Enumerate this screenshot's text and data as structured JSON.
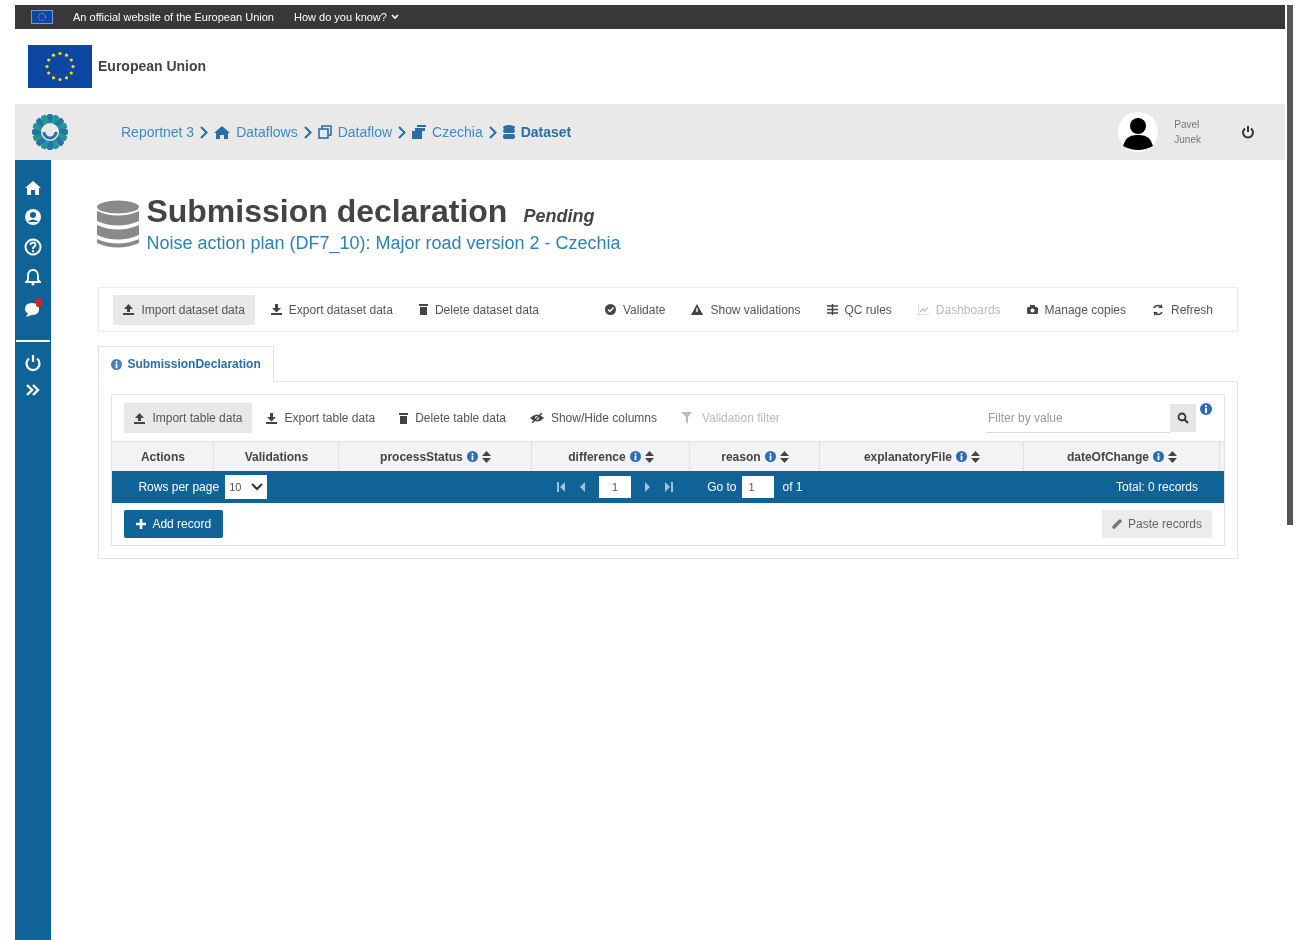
{
  "eu_banner": {
    "text": "An official website of the European Union",
    "link": "How do you know?"
  },
  "header": {
    "title": "European Union"
  },
  "breadcrumb": [
    {
      "label": "Reportnet 3",
      "current": false
    },
    {
      "label": "Dataflows",
      "current": false
    },
    {
      "label": "Dataflow",
      "current": false
    },
    {
      "label": "Czechia",
      "current": false
    },
    {
      "label": "Dataset",
      "current": true
    }
  ],
  "user": {
    "first_name": "Pavel",
    "last_name": "Junek"
  },
  "sidebar": {
    "notification_badge": true
  },
  "page": {
    "title": "Submission declaration",
    "status": "Pending",
    "subtitle": "Noise action plan (DF7_10): Major road version 2 - Czechia"
  },
  "dataset_toolbar": [
    {
      "label": "Import dataset data",
      "selected": true,
      "disabled": false
    },
    {
      "label": "Export dataset data",
      "selected": false,
      "disabled": false
    },
    {
      "label": "Delete dataset data",
      "selected": false,
      "disabled": false
    },
    {
      "label": "Validate",
      "selected": false,
      "disabled": false
    },
    {
      "label": "Show validations",
      "selected": false,
      "disabled": false
    },
    {
      "label": "QC rules",
      "selected": false,
      "disabled": false
    },
    {
      "label": "Dashboards",
      "selected": false,
      "disabled": true
    },
    {
      "label": "Manage copies",
      "selected": false,
      "disabled": false
    },
    {
      "label": "Refresh",
      "selected": false,
      "disabled": false
    }
  ],
  "tabs": [
    {
      "label": "SubmissionDeclaration",
      "selected": true
    }
  ],
  "table_toolbar": [
    {
      "label": "Import table data",
      "selected": true,
      "disabled": false
    },
    {
      "label": "Export table data",
      "selected": false,
      "disabled": false
    },
    {
      "label": "Delete table data",
      "selected": false,
      "disabled": false
    },
    {
      "label": "Show/Hide columns",
      "selected": false,
      "disabled": false
    },
    {
      "label": "Validation filter",
      "selected": false,
      "disabled": true
    }
  ],
  "filter": {
    "placeholder": "Filter by value"
  },
  "table": {
    "columns": [
      {
        "label": "Actions",
        "info": false,
        "sortable": false
      },
      {
        "label": "Validations",
        "info": false,
        "sortable": false
      },
      {
        "label": "processStatus",
        "info": true,
        "sortable": true
      },
      {
        "label": "difference",
        "info": true,
        "sortable": true
      },
      {
        "label": "reason",
        "info": true,
        "sortable": true
      },
      {
        "label": "explanatoryFile",
        "info": true,
        "sortable": true
      },
      {
        "label": "dateOfChange",
        "info": true,
        "sortable": true
      }
    ]
  },
  "paginator": {
    "rows_per_page_label": "Rows per page",
    "rows_per_page": "10",
    "page": "1",
    "goto_label": "Go to",
    "goto_value": "1",
    "page_count": "of 1",
    "total": "Total: 0 records"
  },
  "actions": {
    "add": "Add record",
    "paste": "Paste records"
  }
}
